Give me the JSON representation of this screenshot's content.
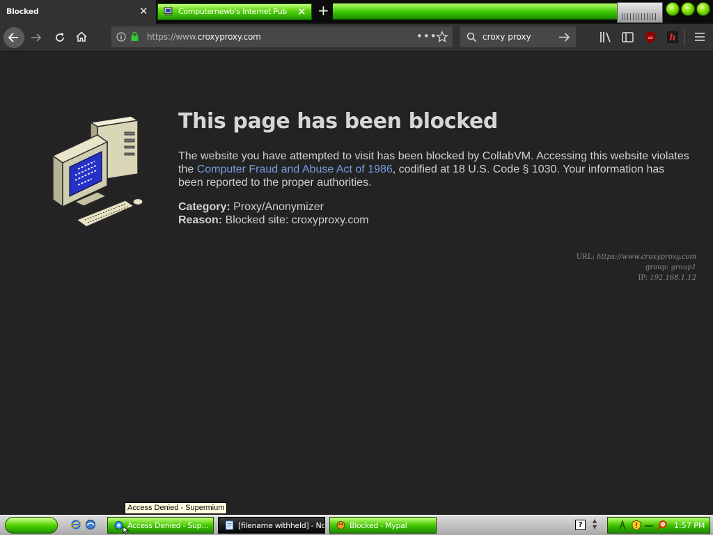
{
  "tabs": [
    {
      "title": "Blocked",
      "active": true
    },
    {
      "title": "Computernewb's Internet Pub Hu",
      "active": false
    }
  ],
  "navbar": {
    "url_prefix": "https://www.",
    "url_host": "croxyproxy.com",
    "search_value": "croxy proxy"
  },
  "page": {
    "title": "This page has been blocked",
    "message_part1": "The website you have attempted to visit has been blocked by CollabVM. Accessing this website violates the ",
    "message_link": "Computer Fraud and Abuse Act of 1986",
    "message_part2": ", codified at 18 U.S. Code § 1030. Your information has been reported to the proper authorities.",
    "category_label": "Category:",
    "category_value": "Proxy/Anonymizer",
    "reason_label": "Reason:",
    "reason_value": "Blocked site: croxyproxy.com",
    "debug": {
      "url_label": "URL:",
      "url_value": "https://www.croxyproxy.com",
      "group_label": "group:",
      "group_value": "group1",
      "ip_label": "IP:",
      "ip_value": "192.168.1.12"
    }
  },
  "taskbar": {
    "tooltip": "Access Denied - Supermium",
    "buttons": [
      {
        "label": "Access Denied - Sup..."
      },
      {
        "label": "[filename withheld] - Notepad"
      },
      {
        "label": "Blocked - Mypal"
      }
    ],
    "clock": "1:57 PM"
  },
  "colors": {
    "page_bg": "#232323",
    "toolbar_bg": "#323232",
    "accent_green": "#45c800",
    "link": "#7a9be0"
  }
}
